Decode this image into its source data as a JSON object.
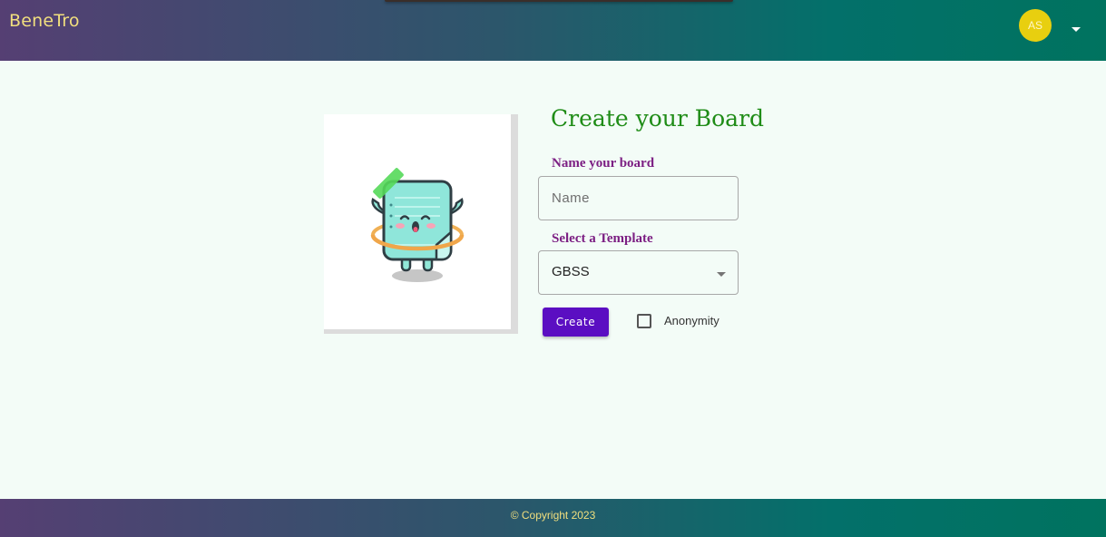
{
  "header": {
    "brand": "BeneTro",
    "avatar_initials": "AS",
    "avatar_color": "#e8cf0f",
    "menu_icon": "caret-down-icon"
  },
  "illustration": {
    "icon": "hula-hoop-paper-mascot"
  },
  "form": {
    "title": "Create your Board",
    "name_label": "Name your board",
    "name_placeholder": "Name",
    "name_value": "",
    "template_label": "Select a Template",
    "template_selected": "GBSS",
    "create_label": "Create",
    "anonymity_label": "Anonymity",
    "anonymity_checked": false
  },
  "footer": {
    "copyright": "© Copyright 2023"
  },
  "colors": {
    "title_green": "#1f8c17",
    "label_purple": "#7c1f83",
    "button_purple": "#5b0ec2",
    "brand_yellow": "#f1df7e"
  }
}
